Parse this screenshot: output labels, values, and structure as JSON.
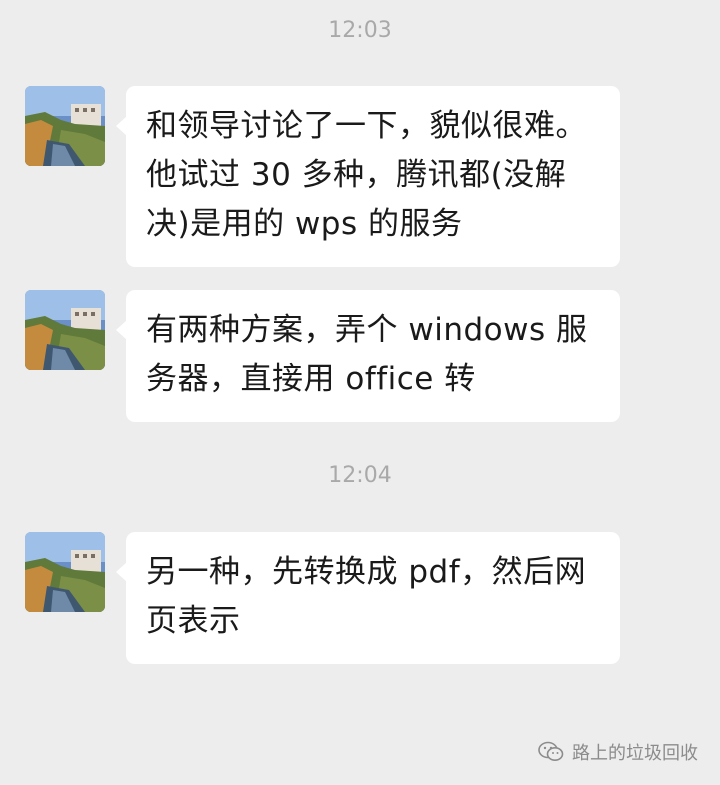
{
  "chat": {
    "timestamps": [
      "12:03",
      "12:04"
    ],
    "messages": [
      {
        "text": "和领导讨论了一下，貌似很难。\n他试过 30 多种，腾讯都(没解\n决)是用的 wps 的服务"
      },
      {
        "text": "有两种方案，弄个 windows 服\n务器，直接用 office 转"
      },
      {
        "text": "另一种，先转换成 pdf，然后网\n页表示"
      }
    ]
  },
  "watermark": {
    "icon": "wechat-icon",
    "text": "路上的垃圾回收"
  }
}
